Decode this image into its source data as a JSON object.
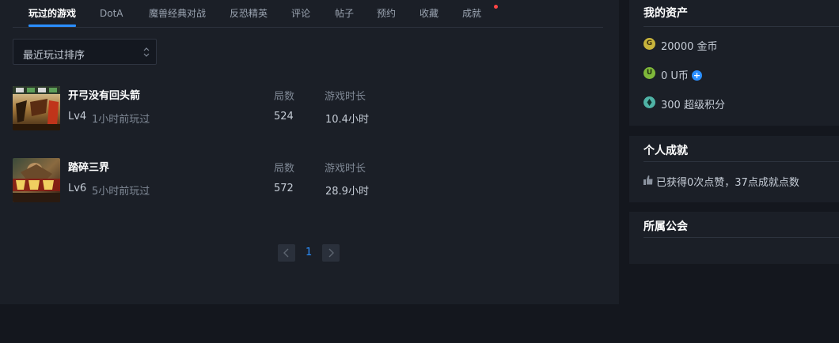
{
  "tabs": [
    {
      "label": "玩过的游戏",
      "active": true
    },
    {
      "label": "DotA"
    },
    {
      "label": "魔兽经典对战"
    },
    {
      "label": "反恐精英"
    },
    {
      "label": "评论"
    },
    {
      "label": "帖子"
    },
    {
      "label": "预约"
    },
    {
      "label": "收藏"
    },
    {
      "label": "成就",
      "has_notification": true
    }
  ],
  "sort": {
    "selected": "最近玩过排序"
  },
  "columns": {
    "rounds": "局数",
    "playtime": "游戏时长"
  },
  "games": [
    {
      "title": "开弓没有回头箭",
      "level": "Lv4",
      "last_played": "1小时前玩过",
      "rounds": "524",
      "playtime": "10.4小时",
      "cover_icon": "game-cover-kaigong"
    },
    {
      "title": "踏碎三界",
      "level": "Lv6",
      "last_played": "5小时前玩过",
      "rounds": "572",
      "playtime": "28.9小时",
      "cover_icon": "game-cover-tasui"
    }
  ],
  "pagination": {
    "current_page": "1"
  },
  "assets": {
    "title": "我的资产",
    "gold": {
      "icon_letter": "G",
      "text": "20000 金币"
    },
    "ucoin": {
      "icon_letter": "U",
      "text": "0 U币"
    },
    "points": {
      "text": "300 超级积分"
    }
  },
  "achievements": {
    "title": "个人成就",
    "text": "已获得0次点赞，37点成就点数"
  },
  "guild": {
    "title": "所属公会"
  },
  "colors": {
    "accent": "#2b8fff",
    "notification": "#ff4545",
    "gold": "#c8b43c",
    "ucoin": "#7fb83a",
    "points": "#4fb3a6"
  }
}
